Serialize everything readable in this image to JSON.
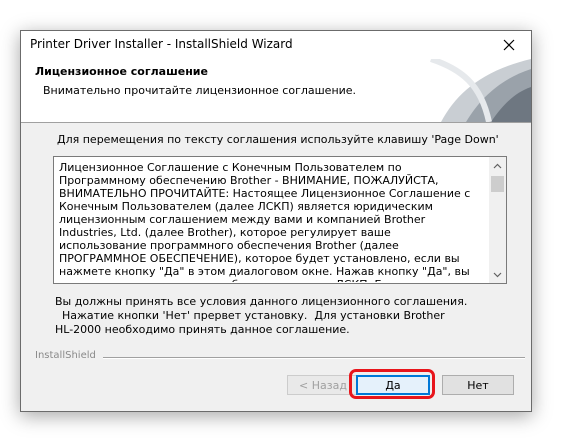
{
  "window": {
    "title": "Printer Driver Installer - InstallShield Wizard"
  },
  "header": {
    "title": "Лицензионное соглашение",
    "subtitle": "Внимательно прочитайте лицензионное соглашение."
  },
  "instruction": "Для перемещения по тексту соглашения используйте клавишу 'Page Down'",
  "license": {
    "text": "Лицензионное Соглашение с Конечным Пользователем по Программному обеспечению Brother - ВНИМАНИЕ, ПОЖАЛУЙСТА, ВНИМАТЕЛЬНО ПРОЧИТАЙТЕ: Настоящее Лицензионное Соглашение с Конечным Пользователем (далее ЛСКП) является юридическим лицензионным соглашением между вами и компанией Brother Industries, Ltd. (далее Brother), которое регулирует ваше использование программного обеспечения Brother (далее ПРОГРАММНОЕ ОБЕСПЕЧЕНИЕ), которое будет установлено, если вы нажмете кнопку \"Да\" в этом диалоговом окне. Нажав кнопку \"Да\", вы соглашаетесь юридически соблюдать условия ЛСКП. Если вы не согласны с условиями ЛСКП, вы не получите лицензию на ПРОГРАММНОЕ ОБЕСПЕЧЕНИЕ"
  },
  "accept_text": "Вы должны принять все условия данного лицензионного соглашения.\n  Нажатие кнопки 'Нет' прервет установку.  Для установки Brother\nHL-2000 необходимо принять данное соглашение.",
  "footer": {
    "brand": "InstallShield",
    "back_label": "< Назад",
    "yes_label": "Да",
    "no_label": "Нет"
  },
  "colors": {
    "accent": "#0078d7",
    "highlight": "#e8151b"
  }
}
